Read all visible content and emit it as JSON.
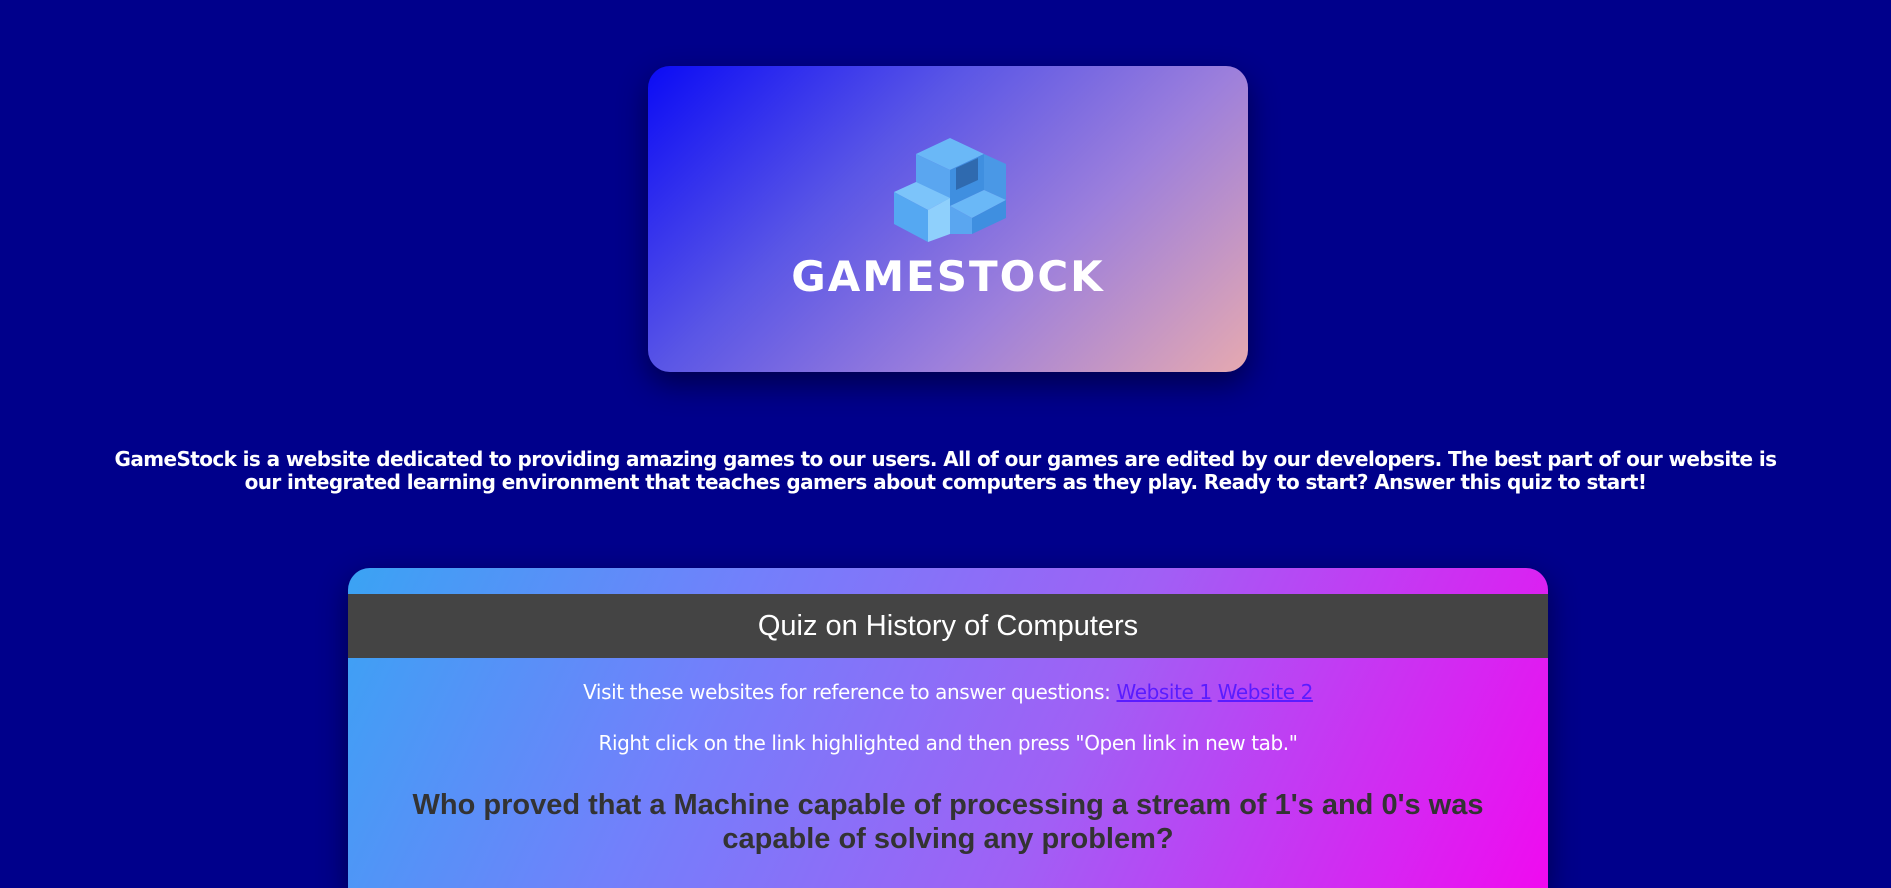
{
  "brand": {
    "name": "GAMESTOCK",
    "logo_icon": "stacked-cubes-icon"
  },
  "intro": {
    "text": "GameStock is a website dedicated to providing amazing games to our users. All of our games are edited by our developers. The best part of our website is our integrated learning environment that teaches gamers about computers as they play. Ready to start? Answer this quiz to start!"
  },
  "quiz": {
    "title": "Quiz on History of Computers",
    "reference_prefix": "Visit these websites for reference to answer questions:",
    "links": [
      {
        "label": "Website 1"
      },
      {
        "label": "Website 2"
      }
    ],
    "instruction": "Right click on the link highlighted and then press \"Open link in new tab.\"",
    "question": "Who proved that a Machine capable of processing a stream of 1's and 0's was capable of solving any problem?"
  },
  "colors": {
    "page_background": "#00008b",
    "quiz_header": "#444444",
    "link": "#5a1cff",
    "question_text": "#333333"
  }
}
